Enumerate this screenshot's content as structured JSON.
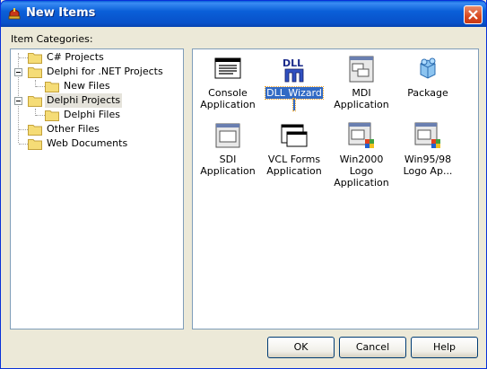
{
  "window": {
    "title": "New Items",
    "icon": "delphi-helmet-icon"
  },
  "categories_label": "Item Categories:",
  "tree": [
    {
      "label": "C# Projects",
      "level": 0,
      "expander": false
    },
    {
      "label": "Delphi for .NET Projects",
      "level": 0,
      "expander": true
    },
    {
      "label": "New Files",
      "level": 1,
      "expander": false
    },
    {
      "label": "Delphi Projects",
      "level": 0,
      "expander": true,
      "selected": true
    },
    {
      "label": "Delphi Files",
      "level": 1,
      "expander": false
    },
    {
      "label": "Other Files",
      "level": 0,
      "expander": false
    },
    {
      "label": "Web Documents",
      "level": 0,
      "expander": false
    }
  ],
  "items": [
    {
      "label": "Console Application",
      "line1": "Console",
      "line2": "Application",
      "icon": "console-app-icon"
    },
    {
      "label": "DLL Wizard",
      "line1": "DLL Wizard",
      "line2": "",
      "icon": "dll-icon",
      "selected": true
    },
    {
      "label": "MDI Application",
      "line1": "MDI",
      "line2": "Application",
      "icon": "mdi-app-icon"
    },
    {
      "label": "Package",
      "line1": "Package",
      "line2": "",
      "icon": "package-icon"
    },
    {
      "label": "SDI Application",
      "line1": "SDI",
      "line2": "Application",
      "icon": "sdi-app-icon"
    },
    {
      "label": "VCL Forms Application",
      "line1": "VCL Forms",
      "line2": "Application",
      "icon": "vcl-forms-icon"
    },
    {
      "label": "Win2000 Logo Application",
      "line1": "Win2000 Logo",
      "line2": "Application",
      "icon": "win2000-logo-icon"
    },
    {
      "label": "Win95/98 Logo Ap...",
      "line1": "Win95/98",
      "line2": "Logo Ap...",
      "icon": "win95-logo-icon"
    }
  ],
  "buttons": {
    "ok": "OK",
    "cancel": "Cancel",
    "help": "Help"
  },
  "colors": {
    "title_bar": "#0a5fd8",
    "selection": "#316ac5",
    "close": "#d9481f",
    "folder": "#f5dc76"
  }
}
